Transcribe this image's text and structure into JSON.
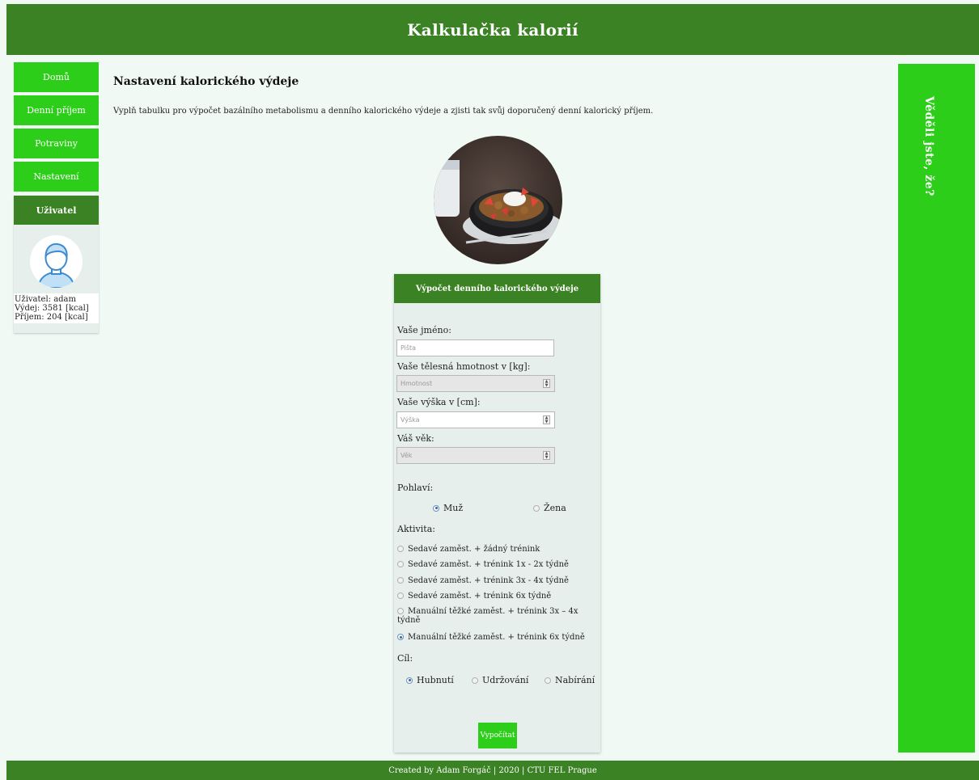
{
  "header": {
    "title": "Kalkulačka kalorií"
  },
  "nav": {
    "items": [
      {
        "label": "Domů"
      },
      {
        "label": "Denní příjem"
      },
      {
        "label": "Potraviny"
      },
      {
        "label": "Nastavení"
      }
    ]
  },
  "user": {
    "heading": "Uživatel",
    "name_line": "Uživatel: adam",
    "expense_line": "Výdej: 3581 [kcal]",
    "intake_line": "Příjem: 204 [kcal]"
  },
  "main": {
    "title": "Nastavení kalorického výdeje",
    "description": "Vyplň tabulku pro výpočet bazálního metabolismu a denního kalorického výdeje a zjisti tak svůj doporučený denní kalorický příjem."
  },
  "form": {
    "heading": "Výpočet denního kalorického výdeje",
    "name_label": "Vaše jméno:",
    "name_placeholder": "Pišta",
    "weight_label": "Vaše tělesná hmotnost v [kg]:",
    "weight_placeholder": "Hmotnost",
    "height_label": "Vaše výška v [cm]:",
    "height_placeholder": "Výška",
    "age_label": "Váš věk:",
    "age_placeholder": "Věk",
    "gender_label": "Pohlaví:",
    "gender_options": [
      {
        "label": "Muž",
        "checked": true
      },
      {
        "label": "Žena",
        "checked": false
      }
    ],
    "activity_label": "Aktivita:",
    "activity_options": [
      {
        "label": "Sedavé zaměst. + žádný trénink",
        "checked": false
      },
      {
        "label": "Sedavé zaměst. + trénink 1x - 2x týdně",
        "checked": false
      },
      {
        "label": "Sedavé zaměst. + trénink 3x - 4x týdně",
        "checked": false
      },
      {
        "label": "Sedavé zaměst. + trénink 6x týdně",
        "checked": false
      },
      {
        "label": "Manuální těžké zaměst. + trénink 3x – 4x týdně",
        "checked": false
      },
      {
        "label": "Manuální těžké zaměst. + trénink 6x týdně",
        "checked": true
      }
    ],
    "goal_label": "Cíl:",
    "goal_options": [
      {
        "label": "Hubnutí",
        "checked": true
      },
      {
        "label": "Udržování",
        "checked": false
      },
      {
        "label": "Nabírání",
        "checked": false
      }
    ],
    "submit_label": "Vypočítat"
  },
  "sidebar_right": {
    "title": "Věděli jste, že?"
  },
  "footer": {
    "text": "Created by Adam Forgáč | 2020 | CTU FEL Prague"
  },
  "colors": {
    "header_green": "#3a8223",
    "bright_green": "#2dce1a",
    "page_bg": "#f0f9f4",
    "card_bg": "#e6efec"
  }
}
